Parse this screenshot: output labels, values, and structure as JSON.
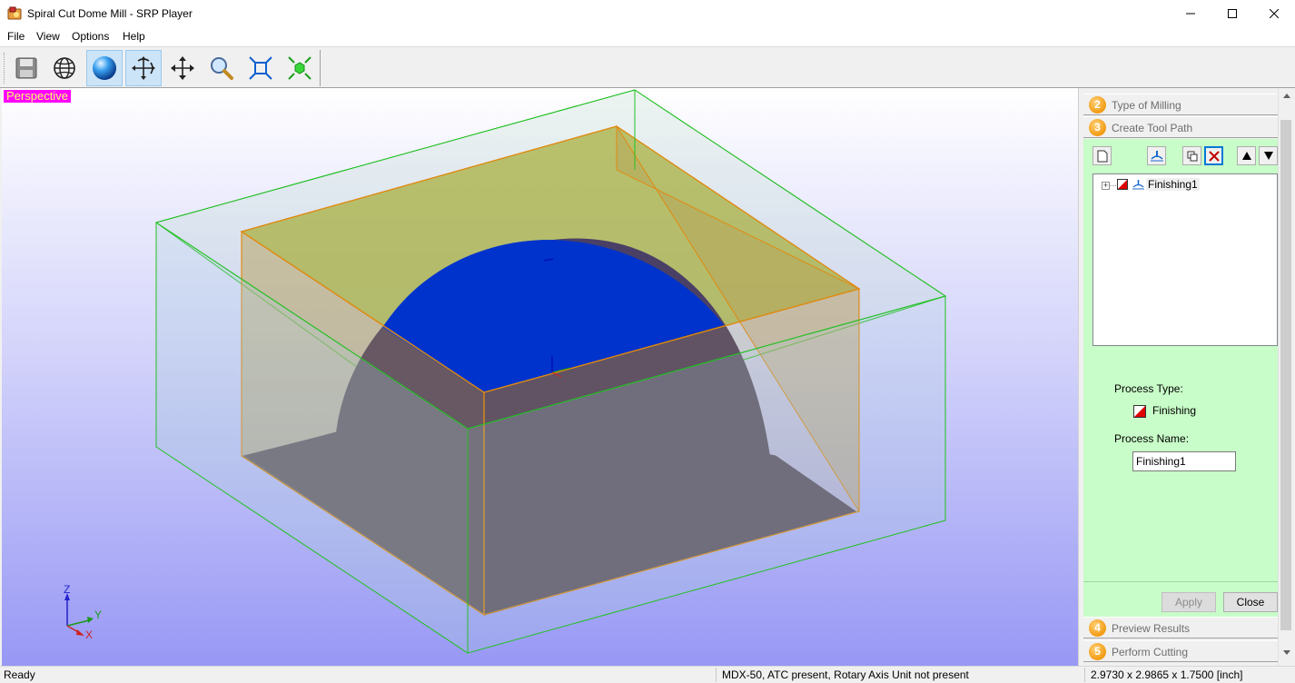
{
  "window": {
    "title": "Spiral Cut Dome Mill - SRP Player",
    "app_icon": "srp-player-app-icon"
  },
  "menu": {
    "items": [
      {
        "label": "File"
      },
      {
        "label": "View"
      },
      {
        "label": "Options"
      },
      {
        "label": "Help"
      }
    ]
  },
  "toolbar": {
    "buttons": [
      {
        "icon": "save-icon",
        "active": false
      },
      {
        "icon": "wireframe-globe-icon",
        "active": false
      },
      {
        "icon": "shaded-sphere-icon",
        "active": true
      },
      {
        "icon": "rotate-view-icon",
        "active": true
      },
      {
        "icon": "pan-view-icon",
        "active": false
      },
      {
        "icon": "zoom-icon",
        "active": false
      },
      {
        "icon": "zoom-fit-icon",
        "active": false
      },
      {
        "icon": "fit-to-model-icon",
        "active": false
      }
    ]
  },
  "viewport": {
    "view_label": "Perspective",
    "axis_labels": {
      "z": "Z",
      "y": "Y",
      "x": "X"
    },
    "colors": {
      "stock_box": "#1fc21f",
      "model_outline": "#e08a10",
      "dome": "#0033cc",
      "model_body": "#4a4066"
    }
  },
  "panel": {
    "steps": [
      {
        "number": "2",
        "label": "Type of Milling"
      },
      {
        "number": "3",
        "label": "Create Tool Path"
      },
      {
        "number": "4",
        "label": "Preview Results"
      },
      {
        "number": "5",
        "label": "Perform Cutting"
      }
    ],
    "tool_buttons": [
      {
        "icon": "new-path-icon"
      },
      {
        "icon": "toolpath-wizard-icon"
      },
      {
        "icon": "copy-path-icon"
      },
      {
        "icon": "delete-path-icon"
      },
      {
        "icon": "move-up-icon"
      },
      {
        "icon": "move-down-icon"
      }
    ],
    "tree": {
      "items": [
        {
          "label": "Finishing1"
        }
      ]
    },
    "process_type_label": "Process Type:",
    "process_type_value": "Finishing",
    "process_name_label": "Process Name:",
    "process_name_value": "Finishing1",
    "apply_label": "Apply",
    "close_label": "Close",
    "accent_color": "#c8fcc8"
  },
  "status": {
    "ready": "Ready",
    "machine": "MDX-50, ATC present, Rotary Axis Unit not present",
    "dimensions": "2.9730 x 2.9865 x 1.7500 [inch]"
  }
}
